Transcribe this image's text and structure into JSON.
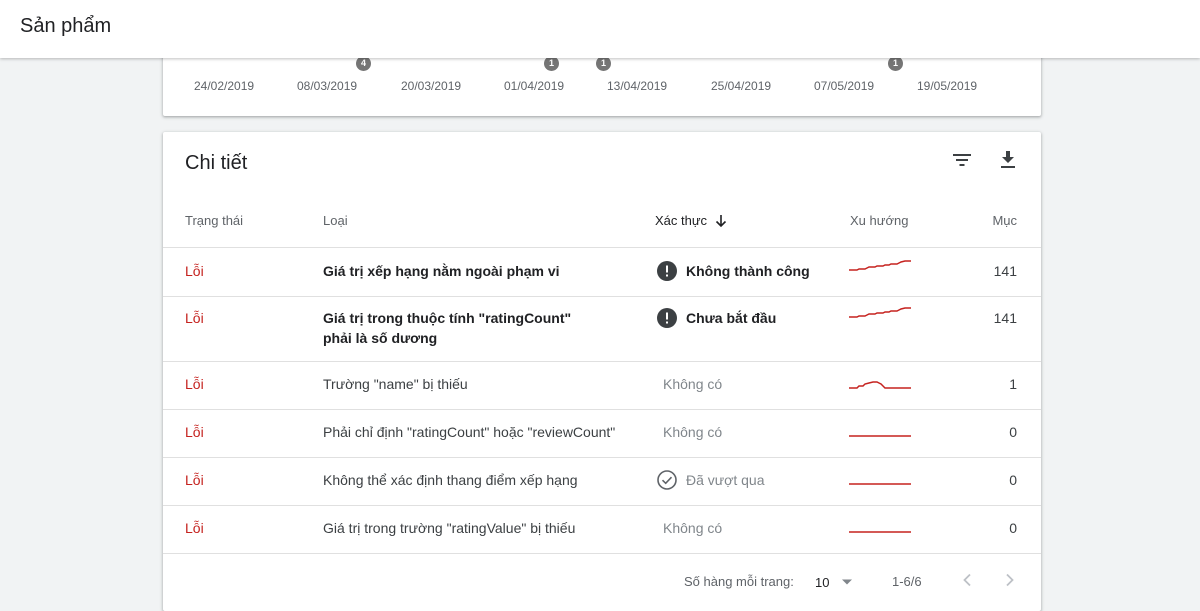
{
  "appbar": {
    "title": "Sản phẩm"
  },
  "timeline": {
    "dates": [
      "24/02/2019",
      "08/03/2019",
      "20/03/2019",
      "01/04/2019",
      "13/04/2019",
      "25/04/2019",
      "07/05/2019",
      "19/05/2019"
    ],
    "badges": [
      "4",
      "1",
      "1",
      "1"
    ]
  },
  "details": {
    "title": "Chi tiết",
    "columns": {
      "status": "Trạng thái",
      "type": "Loại",
      "validation": "Xác thực",
      "trend": "Xu hướng",
      "items": "Mục"
    },
    "rows": [
      {
        "status": "Lỗi",
        "type": "Giá trị xếp hạng nằm ngoài phạm vi",
        "validation": "Không thành công",
        "count": "141"
      },
      {
        "status": "Lỗi",
        "type": "Giá trị trong thuộc tính \"ratingCount\" phải là số dương",
        "validation": "Chưa bắt đầu",
        "count": "141"
      },
      {
        "status": "Lỗi",
        "type": "Trường \"name\" bị thiếu",
        "validation": "Không có",
        "count": "1"
      },
      {
        "status": "Lỗi",
        "type": "Phải chỉ định \"ratingCount\" hoặc \"reviewCount\"",
        "validation": "Không có",
        "count": "0"
      },
      {
        "status": "Lỗi",
        "type": "Không thể xác định thang điểm xếp hạng",
        "validation": "Đã vượt qua",
        "count": "0"
      },
      {
        "status": "Lỗi",
        "type": "Giá trị trong trường \"ratingValue\" bị thiếu",
        "validation": "Không có",
        "count": "0"
      }
    ],
    "footer": {
      "rows_per_page_label": "Số hàng mỗi trang:",
      "rows_per_page": "10",
      "range": "1-6/6"
    }
  },
  "icons": {
    "filter": "filter-icon",
    "download": "download-icon",
    "sort": "arrow-down-icon",
    "error": "exclamation-circle-icon",
    "passed": "check-circle-icon",
    "dropdown": "caret-down-icon",
    "prev": "chevron-left-icon",
    "next": "chevron-right-icon"
  },
  "colors": {
    "error": "#c5221f",
    "trend": "#c5221f",
    "icon_dark": "#3c4043"
  }
}
